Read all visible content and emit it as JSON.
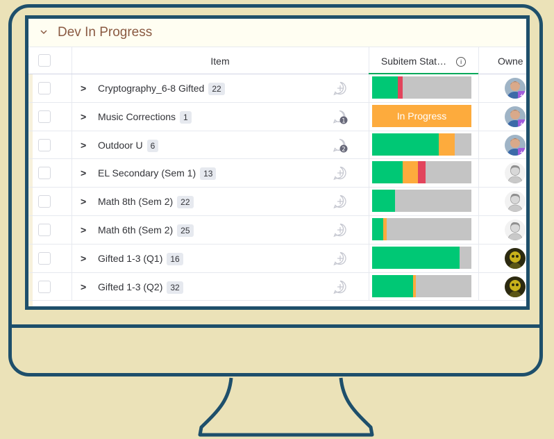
{
  "group": {
    "title": "Dev In Progress"
  },
  "columns": {
    "item": "Item",
    "status": "Subitem Stat…",
    "owner": "Owne"
  },
  "colors": {
    "done": "#00c875",
    "working": "#fdab3d",
    "stuck": "#e2445c",
    "empty": "#c4c4c4",
    "frame": "#1e4f6b"
  },
  "rows": [
    {
      "name": "Cryptography_6-8 Gifted",
      "count": "22",
      "update": "add-update",
      "status": [
        [
          "done",
          0.26
        ],
        [
          "stuck",
          0.05
        ],
        [
          "empty",
          0.69
        ]
      ],
      "avatar": "photo-blue"
    },
    {
      "name": "Music Corrections",
      "count": "1",
      "update": "1",
      "label": "In Progress",
      "avatar": "photo-blue"
    },
    {
      "name": "Outdoor U",
      "count": "6",
      "update": "2",
      "status": [
        [
          "done",
          0.67
        ],
        [
          "working",
          0.16
        ],
        [
          "empty",
          0.17
        ]
      ],
      "avatar": "photo-blue"
    },
    {
      "name": "EL Secondary (Sem 1)",
      "count": "13",
      "update": "add-update",
      "status": [
        [
          "done",
          0.31
        ],
        [
          "working",
          0.15
        ],
        [
          "stuck",
          0.08
        ],
        [
          "empty",
          0.46
        ]
      ],
      "avatar": "photo-gray"
    },
    {
      "name": "Math 8th (Sem 2)",
      "count": "22",
      "update": "add-update",
      "status": [
        [
          "done",
          0.23
        ],
        [
          "empty",
          0.77
        ]
      ],
      "avatar": "photo-gray"
    },
    {
      "name": "Math 6th (Sem 2)",
      "count": "25",
      "update": "add-update",
      "status": [
        [
          "done",
          0.11
        ],
        [
          "working",
          0.04
        ],
        [
          "empty",
          0.85
        ]
      ],
      "avatar": "photo-gray"
    },
    {
      "name": "Gifted 1-3 (Q1)",
      "count": "16",
      "update": "add-update",
      "status": [
        [
          "done",
          0.88
        ],
        [
          "empty",
          0.12
        ]
      ],
      "avatar": "photo-yellow"
    },
    {
      "name": "Gifted 1-3 (Q2)",
      "count": "32",
      "update": "add-update",
      "status": [
        [
          "done",
          0.41
        ],
        [
          "working",
          0.03
        ],
        [
          "empty",
          0.56
        ]
      ],
      "avatar": "photo-yellow"
    }
  ]
}
